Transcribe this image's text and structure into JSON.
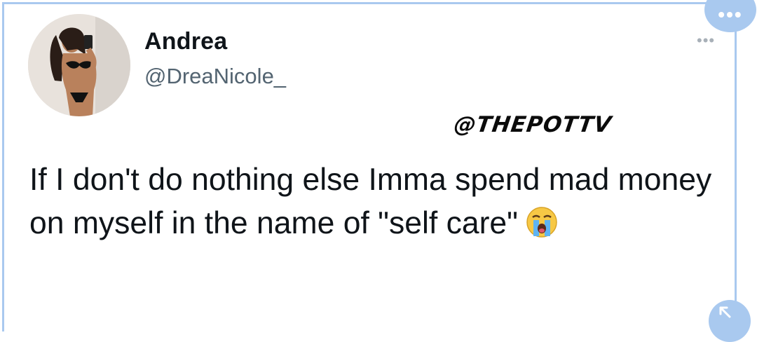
{
  "tweet": {
    "display_name": "Andrea",
    "handle": "@DreaNicole_",
    "watermark": "@THEPOTTV",
    "text": "If I don't do nothing else Imma spend mad money on myself in the name of \"self care\""
  },
  "icons": {
    "more": "more-options-icon",
    "emoji": "loudly-crying-face-icon",
    "overlay_menu": "overflow-menu-icon",
    "overlay_resize": "resize-corner-icon"
  },
  "colors": {
    "frame": "#a9c9ef",
    "name": "#0f1419",
    "handle": "#536471"
  }
}
